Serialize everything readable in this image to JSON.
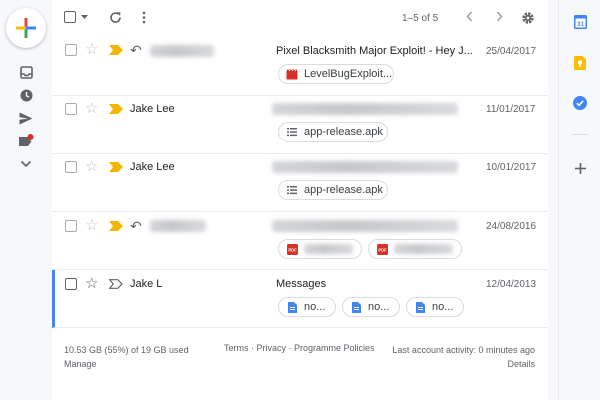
{
  "toolbar": {
    "range_text": "1–5 of 5",
    "icons": [
      "select-all-checkbox",
      "select-dropdown",
      "refresh",
      "more",
      "newer",
      "older",
      "settings"
    ]
  },
  "rail": {
    "icons": [
      "compose",
      "inbox",
      "snoozed",
      "sent",
      "labels",
      "more"
    ]
  },
  "emails": [
    {
      "sender": "",
      "sender_redacted": true,
      "subject": "Pixel Blacksmith Major Exploit! - Hey J...",
      "date": "25/04/2017",
      "replied": true,
      "important": true,
      "attachments": [
        {
          "name": "LevelBugExploit...",
          "icon": "video-icon",
          "color": "#d93025"
        }
      ]
    },
    {
      "sender": "Jake Lee",
      "subject": "",
      "subject_redacted": true,
      "date": "11/01/2017",
      "replied": false,
      "important": true,
      "attachments": [
        {
          "name": "app-release.apk",
          "icon": "list-file-icon",
          "color": "#5f6368"
        }
      ]
    },
    {
      "sender": "Jake Lee",
      "subject": "",
      "subject_redacted": true,
      "date": "10/01/2017",
      "replied": false,
      "important": true,
      "attachments": [
        {
          "name": "app-release.apk",
          "icon": "list-file-icon",
          "color": "#5f6368"
        }
      ]
    },
    {
      "sender": "",
      "sender_redacted": true,
      "subject": "",
      "subject_redacted": true,
      "date": "24/08/2016",
      "replied": true,
      "important": true,
      "attachments": [
        {
          "name": "",
          "icon": "pdf-icon",
          "color": "#d93025",
          "redacted": true
        },
        {
          "name": "",
          "icon": "pdf-icon",
          "color": "#d93025",
          "redacted": true
        }
      ]
    },
    {
      "sender": "Jake L",
      "subject": "Messages",
      "date": "12/04/2013",
      "replied": false,
      "important": false,
      "selected": true,
      "attachments": [
        {
          "name": "no...",
          "icon": "doc-icon",
          "color": "#4285f4"
        },
        {
          "name": "no...",
          "icon": "doc-icon",
          "color": "#4285f4"
        },
        {
          "name": "no...",
          "icon": "doc-icon",
          "color": "#4285f4"
        }
      ]
    }
  ],
  "footer": {
    "storage": "10.53 GB (55%) of 19 GB used",
    "manage": "Manage",
    "links": "Terms · Privacy · Programme Policies",
    "activity": "Last account activity: 0 minutes ago",
    "details": "Details"
  },
  "side_panel": {
    "icons": [
      "calendar-icon",
      "keep-icon",
      "tasks-icon",
      "add-icon"
    ],
    "calendar_label": "31"
  },
  "colors": {
    "important": "#f4b400",
    "selected_border": "#4285f4",
    "label_badge": "#d93025"
  }
}
